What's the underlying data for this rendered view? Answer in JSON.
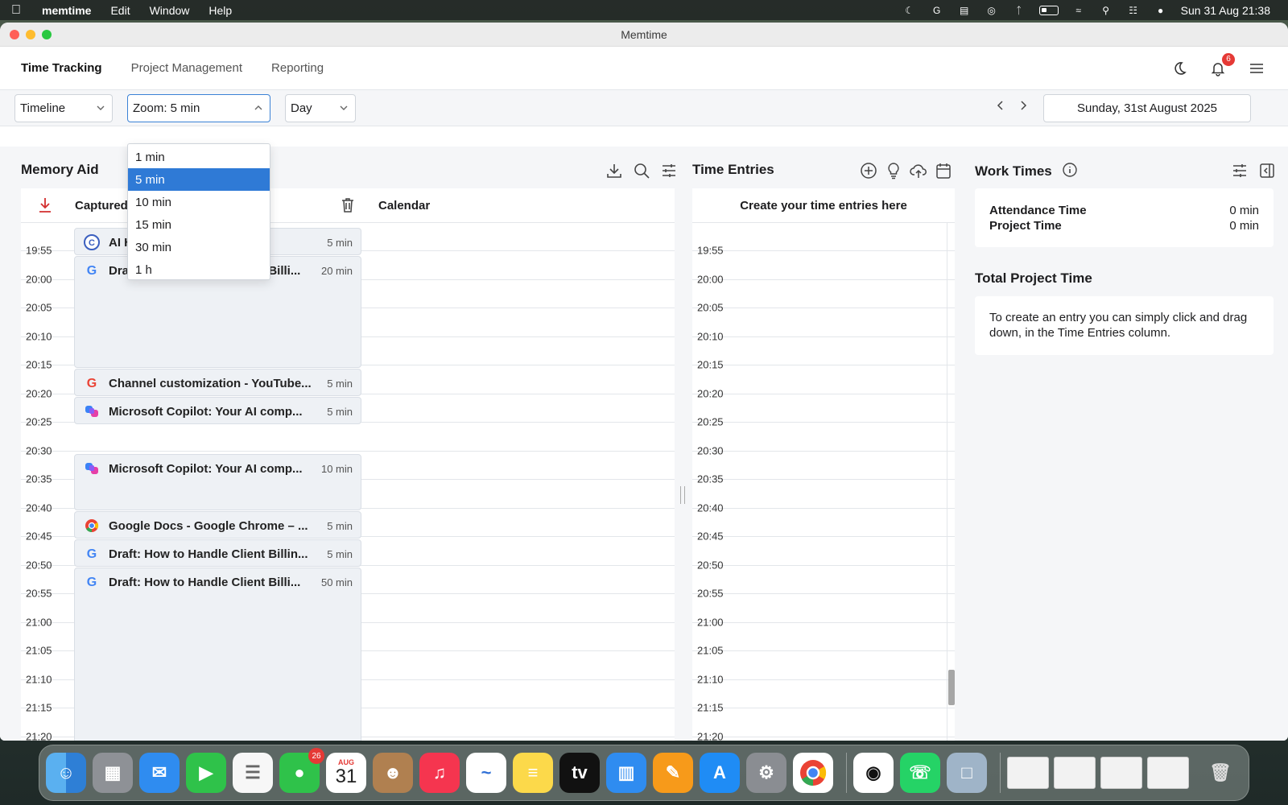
{
  "menubar": {
    "app": "memtime",
    "items": [
      "Edit",
      "Window",
      "Help"
    ],
    "datetime": "Sun 31 Aug  21:38"
  },
  "window": {
    "title": "Memtime"
  },
  "nav": {
    "tabs": [
      "Time Tracking",
      "Project Management",
      "Reporting"
    ],
    "active": "Time Tracking",
    "notifications_count": "6"
  },
  "toolbar": {
    "view_select": "Timeline",
    "zoom_select": "Zoom: 5 min",
    "range_select": "Day",
    "date": "Sunday, 31st August 2025"
  },
  "zoom_options": [
    "1 min",
    "5 min",
    "10 min",
    "15 min",
    "30 min",
    "1 h"
  ],
  "zoom_selected": "5 min",
  "memory_aid": {
    "title": "Memory Aid",
    "captured_label": "Captured",
    "calendar_label": "Calendar",
    "events": [
      {
        "icon": "c",
        "title": "AI Humanizer for ...",
        "duration": "5 min"
      },
      {
        "icon": "google",
        "title": "Draft: How to Handle Client Billi...",
        "duration": "20 min"
      },
      {
        "icon": "google",
        "title": "Channel customization - YouTube...",
        "duration": "5 min"
      },
      {
        "icon": "copilot",
        "title": "Microsoft Copilot: Your AI comp...",
        "duration": "5 min"
      },
      {
        "icon": "copilot",
        "title": "Microsoft Copilot: Your AI comp...",
        "duration": "10 min"
      },
      {
        "icon": "chrome",
        "title": "Google Docs - Google Chrome – ...",
        "duration": "5 min"
      },
      {
        "icon": "google",
        "title": "Draft: How to Handle Client Billin...",
        "duration": "5 min"
      },
      {
        "icon": "google",
        "title": "Draft: How to Handle Client Billi...",
        "duration": "50 min"
      }
    ]
  },
  "time_labels": [
    "19:55",
    "20:00",
    "20:05",
    "20:10",
    "20:15",
    "20:20",
    "20:25",
    "20:30",
    "20:35",
    "20:40",
    "20:45",
    "20:50",
    "20:55",
    "21:00",
    "21:05",
    "21:10",
    "21:15",
    "21:20"
  ],
  "time_entries": {
    "title": "Time Entries",
    "header": "Create your time entries here"
  },
  "work_times": {
    "title": "Work Times",
    "attendance_label": "Attendance Time",
    "attendance_value": "0 min",
    "project_label": "Project Time",
    "project_value": "0 min"
  },
  "total_project_time": {
    "title": "Total Project Time",
    "hint": "To create an entry you can simply click and drag down, in the Time Entries column."
  },
  "dock": {
    "messages_badge": "26",
    "calendar_month": "AUG",
    "calendar_day": "31"
  },
  "colors": {
    "accent": "#2f7ad6",
    "badge": "#e53935",
    "event_bg": "#eef1f5"
  }
}
